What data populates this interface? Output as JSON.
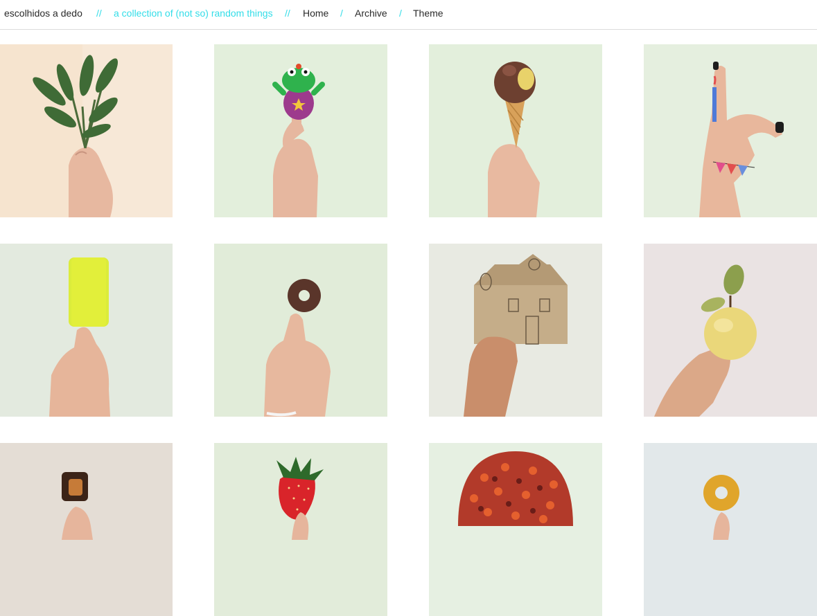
{
  "header": {
    "site_title": "escolhidos a dedo",
    "separator_1": "//",
    "tagline": "a collection of (not so) random things",
    "separator_2": "//",
    "nav": [
      {
        "label": "Home"
      },
      {
        "label": "Archive"
      },
      {
        "label": "Theme"
      }
    ],
    "nav_separator": "/"
  },
  "colors": {
    "accent": "#33dde8",
    "text": "#2a2a2a",
    "divider": "#dcdcdc"
  },
  "gallery": {
    "photos": [
      {
        "subject": "leafy-herb-sprig",
        "bg": "#f6e4cf"
      },
      {
        "subject": "green-frog-toy",
        "bg": "#e3efdc"
      },
      {
        "subject": "chocolate-ice-cream-cone",
        "bg": "#e3efdc"
      },
      {
        "subject": "drawn-candle-and-bunting-hand",
        "bg": "#e5efdf"
      },
      {
        "subject": "blurred-yellow-cylinder",
        "bg": "#e3eadf"
      },
      {
        "subject": "chocolate-donut-on-finger",
        "bg": "#e1ecd9"
      },
      {
        "subject": "cardboard-house",
        "bg": "#e8eae2"
      },
      {
        "subject": "yellow-apple-with-leaves",
        "bg": "#eae3e3"
      },
      {
        "subject": "chocolate-caramel-bite",
        "bg": "#e4ddd5"
      },
      {
        "subject": "strawberry",
        "bg": "#e2ecda"
      },
      {
        "subject": "crochet-beanie",
        "bg": "#e6f0e2"
      },
      {
        "subject": "glazed-donut",
        "bg": "#e2e8ea"
      }
    ]
  }
}
